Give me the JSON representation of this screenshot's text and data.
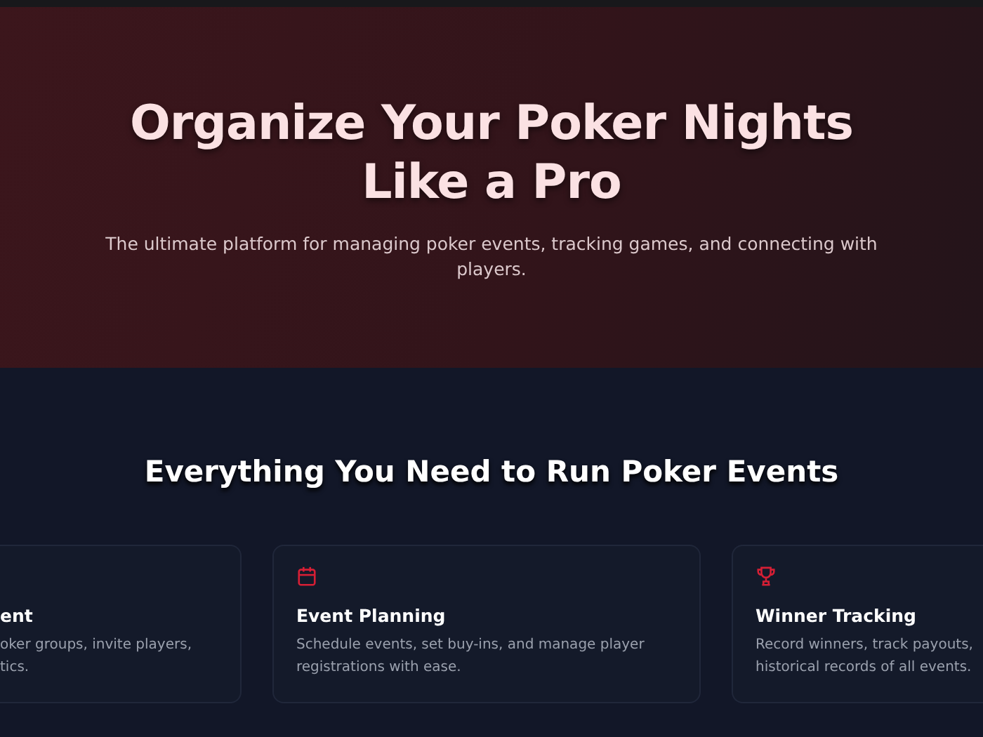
{
  "hero": {
    "title_lines": [
      "Organize Your Poker Nights",
      "Like a Pro"
    ],
    "subtitle": "The ultimate platform for managing poker events, tracking games, and connecting with players."
  },
  "features": {
    "heading": "Everything You Need to Run Poker Events",
    "cards": [
      {
        "kind": "none",
        "title": "ent",
        "description_lines": [
          "oker groups, invite players,",
          "tics."
        ]
      },
      {
        "kind": "calendar",
        "title": "Event Planning",
        "description_lines": [
          "Schedule events, set buy-ins, and manage player",
          "registrations with ease."
        ]
      },
      {
        "kind": "trophy",
        "title": "Winner Tracking",
        "description_lines": [
          "Record winners, track payouts,",
          "historical records of all events."
        ]
      }
    ]
  }
}
